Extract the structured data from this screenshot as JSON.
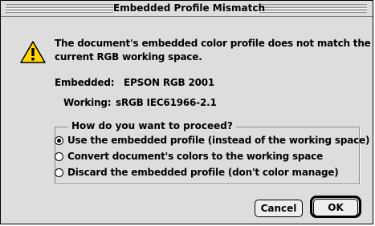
{
  "window": {
    "title": "Embedded Profile Mismatch"
  },
  "message": {
    "line1": "The document's embedded color profile does not match the",
    "line2": "current RGB working space."
  },
  "embedded": {
    "label": "Embedded:",
    "value": "EPSON RGB 2001"
  },
  "working": {
    "label": "Working:",
    "value": "sRGB IEC61966-2.1"
  },
  "options": {
    "legend": "How do you want to proceed?",
    "items": [
      {
        "label": "Use the embedded profile (instead of the working space)",
        "selected": true
      },
      {
        "label": "Convert document's colors to the working space",
        "selected": false
      },
      {
        "label": "Discard the embedded profile (don't color manage)",
        "selected": false
      }
    ]
  },
  "buttons": {
    "cancel": "Cancel",
    "ok": "OK"
  },
  "icons": {
    "warning": "warning-icon",
    "warning_color": "#ffd400"
  }
}
